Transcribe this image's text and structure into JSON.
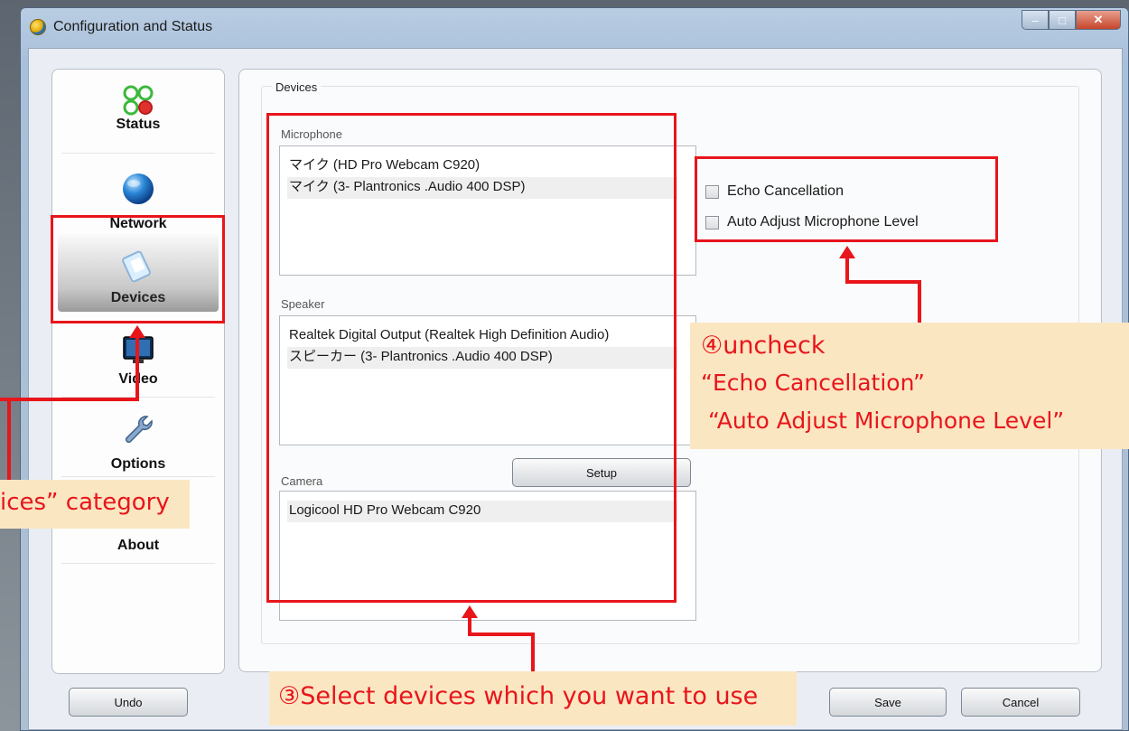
{
  "window": {
    "title": "Configuration and Status",
    "controls": {
      "minimize": "–",
      "maximize": "□",
      "close": "✕"
    }
  },
  "sidebar": {
    "items": [
      {
        "label": "Status",
        "icon": "status-lights-icon"
      },
      {
        "label": "Network",
        "icon": "globe-icon"
      },
      {
        "label": "Devices",
        "icon": "devices-icon",
        "selected": true
      },
      {
        "label": "Video",
        "icon": "monitor-icon"
      },
      {
        "label": "Options",
        "icon": "wrench-icon"
      },
      {
        "label": "About",
        "icon": "info-icon"
      }
    ]
  },
  "devices": {
    "group_title": "Devices",
    "microphone": {
      "label": "Microphone",
      "items": [
        "マイク (HD Pro Webcam C920)",
        "マイク (3- Plantronics .Audio 400 DSP)"
      ],
      "selected_index": 1
    },
    "speaker": {
      "label": "Speaker",
      "items": [
        "Realtek Digital Output (Realtek High Definition Audio)",
        "スピーカー (3- Plantronics .Audio 400 DSP)"
      ],
      "selected_index": 1
    },
    "camera": {
      "label": "Camera",
      "items": [
        "Logicool HD Pro Webcam C920"
      ],
      "selected_index": 0
    },
    "setup_button": "Setup",
    "options": [
      {
        "label": "Echo Cancellation",
        "checked": false
      },
      {
        "label": "Auto Adjust Microphone Level",
        "checked": false
      }
    ]
  },
  "footer": {
    "undo": "Undo",
    "save": "Save",
    "cancel": "Cancel"
  },
  "annotations": {
    "step3": "③Select devices which you want to use",
    "step4_line1": "④uncheck",
    "step4_line2": "“Echo Cancellation”",
    "step4_line3": "“Auto Adjust Microphone Level”",
    "step2_partial": "ices” category",
    "accent_color": "#e8151b",
    "note_background": "#fbe6c2"
  }
}
